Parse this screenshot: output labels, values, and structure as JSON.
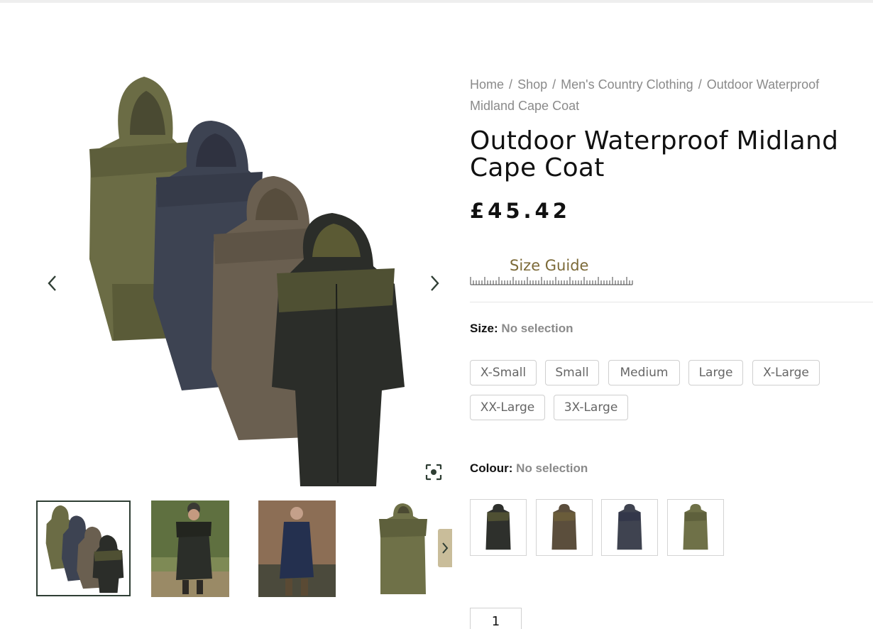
{
  "breadcrumb": {
    "home": "Home",
    "shop": "Shop",
    "category": "Men's Country Clothing",
    "current": "Outdoor Waterproof Midland Cape Coat",
    "separator": "/"
  },
  "product": {
    "title": "Outdoor Waterproof Midland Cape Coat",
    "price": "£45.42"
  },
  "size_guide": {
    "label": "Size Guide"
  },
  "size": {
    "label": "Size:",
    "selection": "No selection",
    "options": [
      "X-Small",
      "Small",
      "Medium",
      "Large",
      "X-Large",
      "XX-Large",
      "3X-Large"
    ]
  },
  "colour": {
    "label": "Colour:",
    "selection": "No selection",
    "swatches": [
      {
        "color": "#2e302c"
      },
      {
        "color": "#5b4e3c"
      },
      {
        "color": "#3f4350"
      },
      {
        "color": "#6f7148"
      }
    ]
  },
  "quantity": {
    "value": "1"
  },
  "colors": {
    "accent_gold": "#7c6a38",
    "thumb_nav_bg": "#c9bd9a",
    "active_thumb_border": "#2f3e34",
    "coat_olive": "#6b6c45",
    "coat_navy": "#3d4352",
    "coat_brown": "#6a5f50",
    "coat_black": "#2b2d29"
  },
  "icons": {
    "prev": "chevron-left-icon",
    "next": "chevron-right-icon",
    "zoom": "zoom-focus-icon",
    "thumb_next": "chevron-right-icon"
  }
}
